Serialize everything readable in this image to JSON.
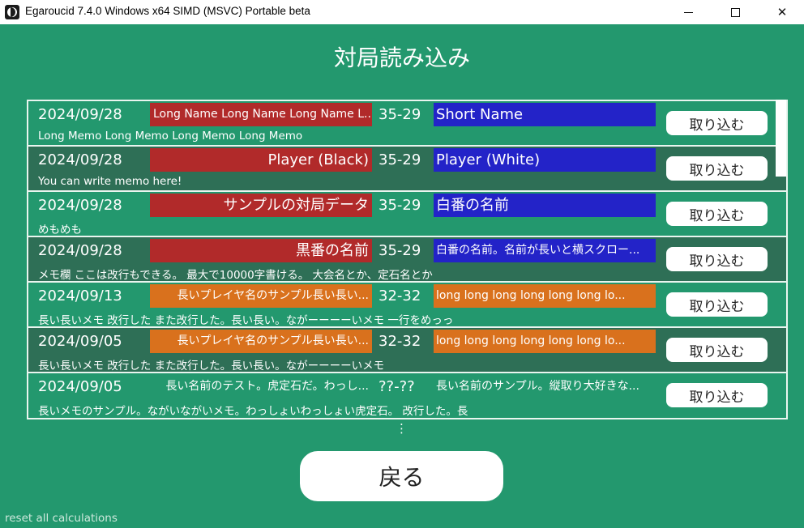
{
  "window": {
    "title": "Egaroucid 7.4.0 Windows x64 SIMD (MSVC) Portable beta",
    "minimize": "–",
    "close": "✕"
  },
  "page_title": "対局読み込み",
  "colors": {
    "background": "#23986e",
    "red": "#b12a2a",
    "blue": "#2323c8",
    "orange": "#d9711d"
  },
  "games": [
    {
      "date": "2024/09/28",
      "black": "Long Name Long Name Long Name L...",
      "score": "35-29",
      "white": "Short Name",
      "memo": "Long Memo Long Memo Long Memo Long Memo",
      "button": "取り込む"
    },
    {
      "date": "2024/09/28",
      "black": "Player (Black)",
      "score": "35-29",
      "white": "Player (White)",
      "memo": "You can write memo here!",
      "button": "取り込む"
    },
    {
      "date": "2024/09/28",
      "black": "サンプルの対局データ",
      "score": "35-29",
      "white": "白番の名前",
      "memo": "めもめも",
      "button": "取り込む"
    },
    {
      "date": "2024/09/28",
      "black": "黒番の名前",
      "score": "35-29",
      "white": "白番の名前。名前が長いと横スクロー...",
      "memo": "メモ欄 ここは改行もできる。 最大で10000字書ける。 大会名とか、定石名とか",
      "button": "取り込む"
    },
    {
      "date": "2024/09/13",
      "black": "長いプレイヤ名のサンプル長い長い...",
      "score": "32-32",
      "white": "long long long long long long lo...",
      "memo": "長い長いメモ 改行した また改行した。長い長い。ながーーーーいメモ 一行をめっっ",
      "button": "取り込む"
    },
    {
      "date": "2024/09/05",
      "black": "長いプレイヤ名のサンプル長い長い...",
      "score": "32-32",
      "white": "long long long long long long lo...",
      "memo": "長い長いメモ 改行した また改行した。長い長い。ながーーーーいメモ",
      "button": "取り込む"
    },
    {
      "date": "2024/09/05",
      "black": "長い名前のテスト。虎定石だ。わっし...",
      "score": "??-??",
      "white": "長い名前のサンプル。縦取り大好きな...",
      "memo": "長いメモのサンプル。ながいながいメモ。わっしょいわっしょい虎定石。 改行した。長",
      "button": "取り込む"
    }
  ],
  "more_indicator": "⋮",
  "back_button": "戻る",
  "reset_link": "reset all calculations"
}
